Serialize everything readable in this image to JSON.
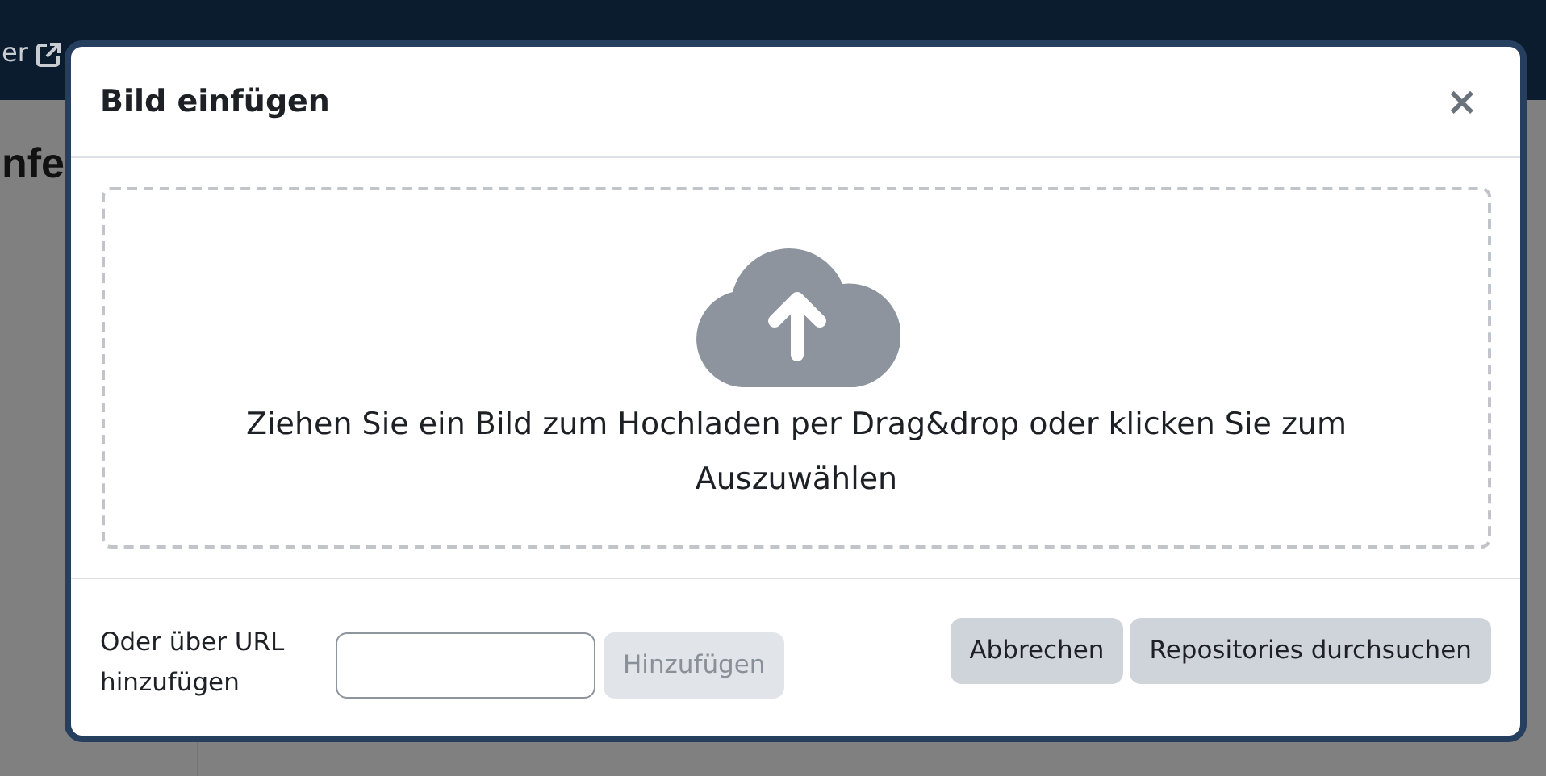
{
  "navbar": {
    "link": "er"
  },
  "page": {
    "heading": "nfe"
  },
  "dialog": {
    "title": "Bild einfügen",
    "close": "×",
    "dropzone": {
      "text": "Ziehen Sie ein Bild zum Hochladen per Drag&drop oder klicken Sie zum Auszuwählen"
    },
    "url": {
      "label": "Oder über URL hinzufügen",
      "add_button": {
        "label": "Hinzufügen",
        "disabled": true
      }
    },
    "buttons": [
      "Abbrechen",
      "Repositories durchsuchen"
    ]
  }
}
